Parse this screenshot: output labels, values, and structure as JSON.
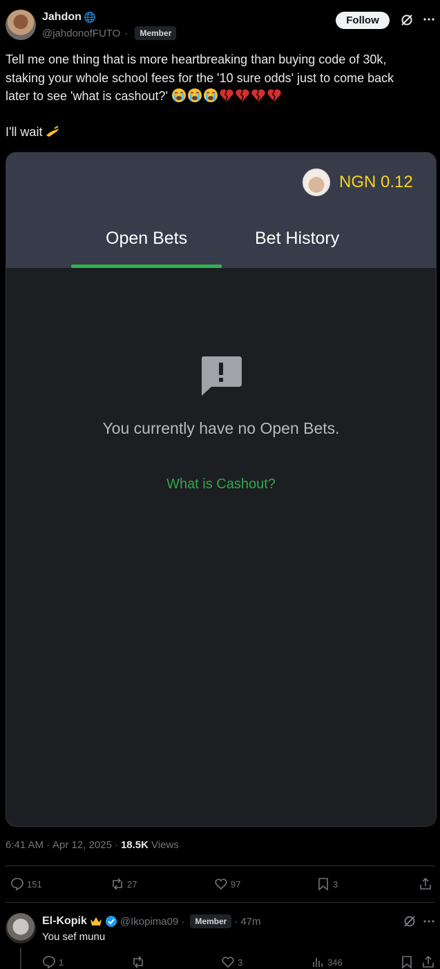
{
  "post": {
    "author_name": "Jahdon",
    "author_handle": "@jahdonofFUTO",
    "separator": "·",
    "badge": "Member",
    "follow_label": "Follow",
    "text_line1": "Tell me one thing that is more heartbreaking than buying code of 30k,",
    "text_line2": "staking your whole school fees for the '10 sure odds' just to come back",
    "text_line3": "later to see 'what is cashout?'",
    "text_wait": "I'll wait"
  },
  "screenshot": {
    "balance": "NGN 0.12",
    "tabs": [
      "Open Bets",
      "Bet History"
    ],
    "empty_message": "You currently have no Open Bets.",
    "link": "What is Cashout?",
    "colors": {
      "header_bg": "#383c4a",
      "body_bg": "#1d1e22",
      "accent_green": "#2eb34e",
      "balance_yellow": "#f7d31e"
    }
  },
  "meta": {
    "time": "6:41 AM",
    "date": "Apr 12, 2025",
    "views_count": "18.5K",
    "views_label": "Views"
  },
  "actions": {
    "replies": "151",
    "reposts": "27",
    "likes": "97",
    "bookmarks": "3"
  },
  "reply": {
    "author_name": "El-Kopik",
    "author_handle": "@Ikopima09",
    "badge": "Member",
    "time": "47m",
    "text": "You sef munu",
    "replies": "1",
    "likes": "3",
    "views": "346"
  }
}
